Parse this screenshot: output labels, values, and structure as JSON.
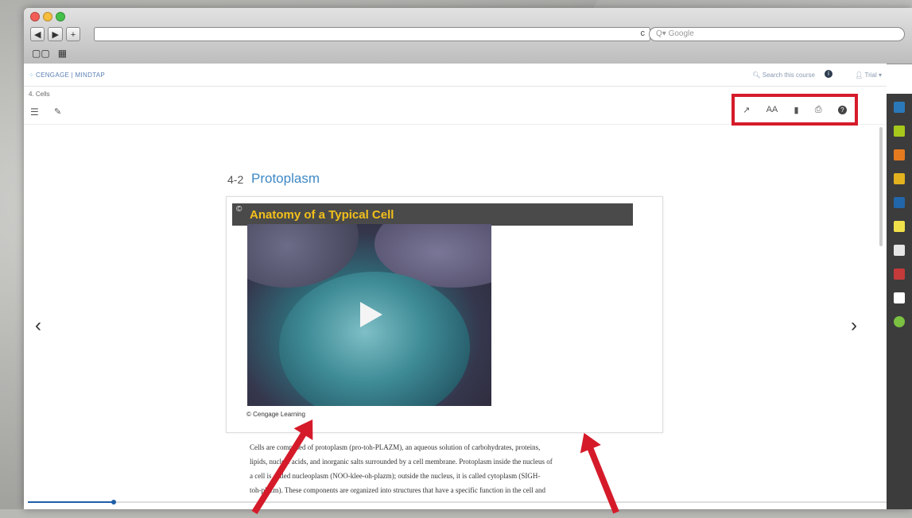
{
  "browser": {
    "nav_back": "◀",
    "nav_fwd": "▶",
    "new_tab": "+",
    "reload": "c",
    "search_placeholder": "Q▾ Google",
    "bookmarks_icon": "▢▢",
    "topsites_icon": "▦"
  },
  "app": {
    "brand": "CENGAGE | MINDTAP",
    "search_course": "Search this course",
    "info": "i",
    "user": "Trial ▾"
  },
  "breadcrumb": "4. Cells",
  "toolbar": {
    "toc_icon": "☰",
    "notes_icon": "✎",
    "right_tools": [
      "↗",
      "AA",
      "▮",
      "⎙",
      "?"
    ]
  },
  "section": {
    "number": "4-2",
    "title": "Protoplasm"
  },
  "media_card": {
    "header_icon": "©",
    "header_title": "Anatomy of a Typical Cell",
    "credit": "© Cengage Learning"
  },
  "body_text": [
    "Cells are composed of protoplasm (pro-toh-PLAZM), an aqueous solution of carbohydrates, proteins,",
    "lipids, nucleic acids, and inorganic salts surrounded by a cell membrane. Protoplasm inside the nucleus of",
    "a cell is called nucleoplasm (NOO-klee-oh-plazm); outside the nucleus, it is called cytoplasm (SIGH-",
    "toh-plazm). These components are organized into structures that have a specific function in the cell and"
  ],
  "pager": {
    "prev": "‹",
    "next": "›"
  },
  "progress_fraction": 0.1,
  "dock_icons": [
    {
      "name": "book-icon",
      "color": "#2a7ab9"
    },
    {
      "name": "highlighter-icon",
      "color": "#a7c91b"
    },
    {
      "name": "rss-icon",
      "color": "#e67a1e"
    },
    {
      "name": "flashcard-icon",
      "color": "#e2b21f"
    },
    {
      "name": "notebook-icon",
      "color": "#2266aa"
    },
    {
      "name": "sticky-note-icon",
      "color": "#f0e14a"
    },
    {
      "name": "share-icon",
      "color": "#e6e6e6"
    },
    {
      "name": "calendar-icon",
      "color": "#c43a3a"
    },
    {
      "name": "chat-icon",
      "color": "#ffffff"
    },
    {
      "name": "circle-app-icon",
      "color": "#7bc142"
    }
  ]
}
